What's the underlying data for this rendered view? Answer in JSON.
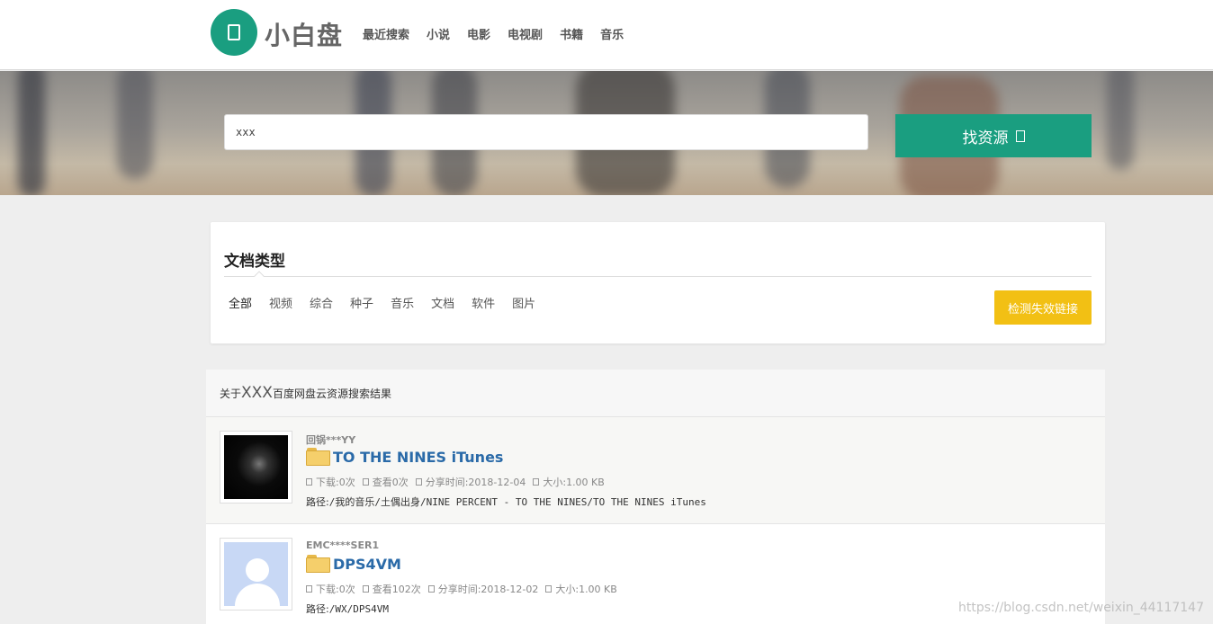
{
  "header": {
    "logo_text": "小白盘",
    "nav": [
      "最近搜索",
      "小说",
      "电影",
      "电视剧",
      "书籍",
      "音乐"
    ]
  },
  "search": {
    "value": "xxx",
    "button_label": "找资源"
  },
  "filter": {
    "title": "文档类型",
    "tabs": [
      "全部",
      "视频",
      "综合",
      "种子",
      "音乐",
      "文档",
      "软件",
      "图片"
    ],
    "check_button": "检测失效链接"
  },
  "results": {
    "prefix": "关于",
    "keyword": "XXX",
    "suffix": "百度网盘云资源搜索结果",
    "items": [
      {
        "user": "回锅***YY",
        "title": "TO THE NINES iTunes",
        "downloads": "下载:0次",
        "views": "查看0次",
        "share_time": "分享时间:2018-12-04",
        "size": "大小:1.00 KB",
        "path_label": "路径:",
        "path": "/我的音乐/土偶出身/NINE PERCENT - TO THE NINES/TO THE NINES iTunes"
      },
      {
        "user": "EMC****SER1",
        "title": "DPS4VM",
        "downloads": "下载:0次",
        "views": "查看102次",
        "share_time": "分享时间:2018-12-02",
        "size": "大小:1.00 KB",
        "path_label": "路径:",
        "path": "/WX/DPS4VM"
      }
    ]
  },
  "watermark": "https://blog.csdn.net/weixin_44117147",
  "colors": {
    "accent": "#1a9e80",
    "warning": "#f2c014",
    "link": "#2a6aa8"
  }
}
